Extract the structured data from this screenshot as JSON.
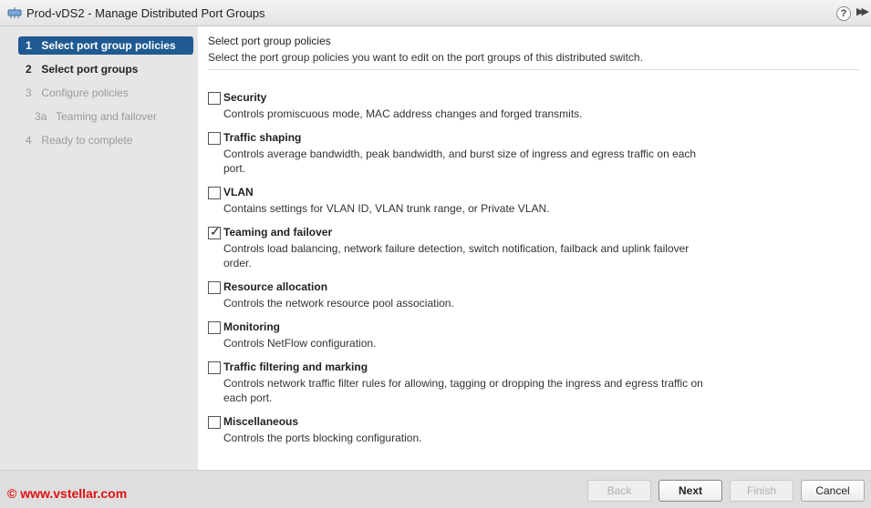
{
  "window": {
    "title": "Prod-vDS2 - Manage Distributed Port Groups",
    "help_glyph": "?",
    "expand_glyph": "▶▶"
  },
  "steps": [
    {
      "num": "1",
      "label": "Select port group policies"
    },
    {
      "num": "2",
      "label": "Select port groups"
    },
    {
      "num": "3",
      "label": "Configure policies"
    },
    {
      "num": "3a",
      "label": "Teaming and failover"
    },
    {
      "num": "4",
      "label": "Ready to complete"
    }
  ],
  "content": {
    "title": "Select port group policies",
    "subtitle": "Select the port group policies you want to edit on the port groups of this distributed switch."
  },
  "options": [
    {
      "label": "Security",
      "desc": "Controls promiscuous mode, MAC address changes and forged transmits.",
      "checked": false
    },
    {
      "label": "Traffic shaping",
      "desc": "Controls average bandwidth, peak bandwidth, and burst size of ingress and egress traffic on each port.",
      "checked": false
    },
    {
      "label": "VLAN",
      "desc": "Contains settings for VLAN ID, VLAN trunk range, or Private VLAN.",
      "checked": false
    },
    {
      "label": "Teaming and failover",
      "desc": "Controls load balancing, network failure detection, switch notification, failback and uplink failover order.",
      "checked": true
    },
    {
      "label": "Resource allocation",
      "desc": "Controls the network resource pool association.",
      "checked": false
    },
    {
      "label": "Monitoring",
      "desc": "Controls NetFlow configuration.",
      "checked": false
    },
    {
      "label": "Traffic filtering and marking",
      "desc": "Controls network traffic filter rules for allowing, tagging or dropping the ingress and egress traffic on each port.",
      "checked": false
    },
    {
      "label": "Miscellaneous",
      "desc": "Controls the ports blocking configuration.",
      "checked": false
    }
  ],
  "check_glyph": "✓",
  "footer": {
    "copyright": "© www.vstellar.com",
    "back": "Back",
    "next": "Next",
    "finish": "Finish",
    "cancel": "Cancel"
  }
}
